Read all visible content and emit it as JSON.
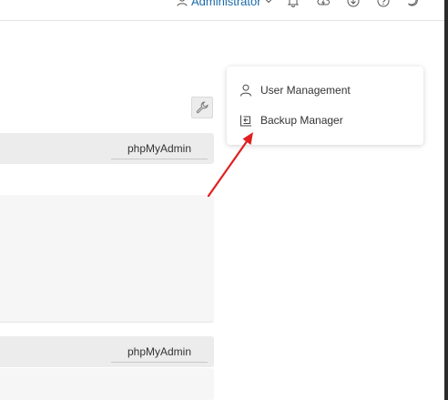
{
  "header": {
    "user_label": "Administrator",
    "icons": [
      "bell-icon",
      "cloud-icon",
      "download-icon",
      "help-icon",
      "moon-icon"
    ]
  },
  "widgets": [
    {
      "title": "phpMyAdmin"
    },
    {
      "title": "phpMyAdmin"
    }
  ],
  "user_menu": {
    "items": [
      {
        "label": "User Management",
        "icon": "user-icon"
      },
      {
        "label": "Backup Manager",
        "icon": "backup-icon"
      }
    ]
  },
  "colors": {
    "accent_link": "#1a6aa8",
    "annotation_arrow": "#e02020",
    "header_bg": "#ececec"
  }
}
